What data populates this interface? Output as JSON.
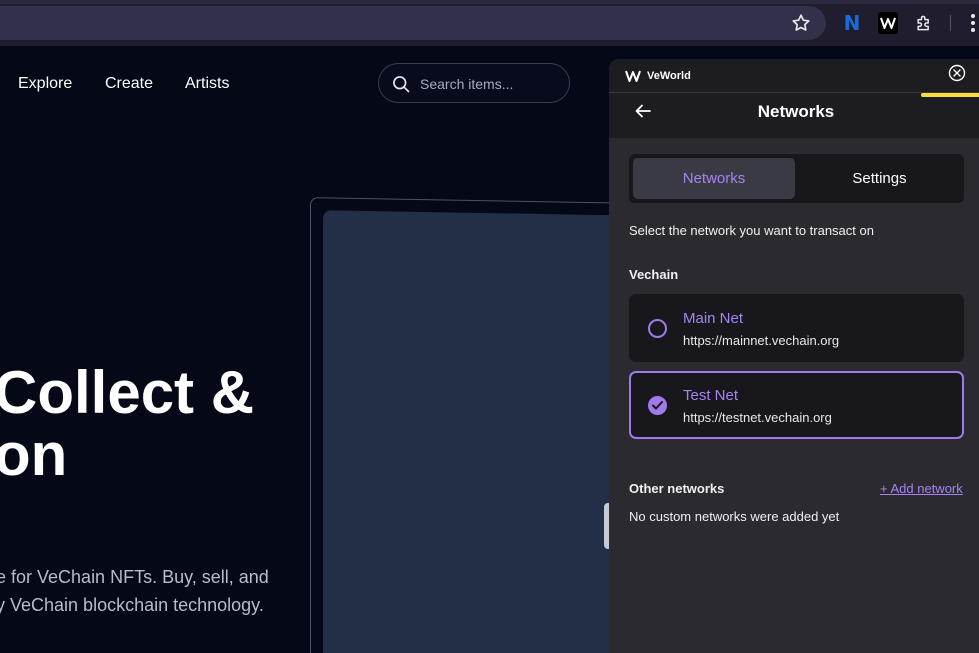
{
  "browser": {
    "extensions": [
      {
        "name": "n-extension-icon",
        "letter": "N",
        "color": "#1a6ad8"
      },
      {
        "name": "veworld-extension-icon"
      },
      {
        "name": "puzzle-icon"
      }
    ]
  },
  "site": {
    "nav": [
      "Explore",
      "Create",
      "Artists"
    ],
    "search_placeholder": "Search items...",
    "hero_line1": "Collect &",
    "hero_line2": "on",
    "desc_line1": "e for VeChain NFTs. Buy, sell, and",
    "desc_line2": "y VeChain blockchain technology."
  },
  "wallet": {
    "app_name": "VeWorld",
    "title": "Networks",
    "tabs": [
      "Networks",
      "Settings"
    ],
    "active_tab": "Networks",
    "instruction": "Select the network you want to transact on",
    "group_label": "Vechain",
    "networks": [
      {
        "name": "Main Net",
        "url": "https://mainnet.vechain.org",
        "selected": false
      },
      {
        "name": "Test Net",
        "url": "https://testnet.vechain.org",
        "selected": true
      }
    ],
    "other_label": "Other networks",
    "add_network": "+ Add network",
    "empty_message": "No custom networks were added yet",
    "accent_color": "#9f7aea"
  }
}
